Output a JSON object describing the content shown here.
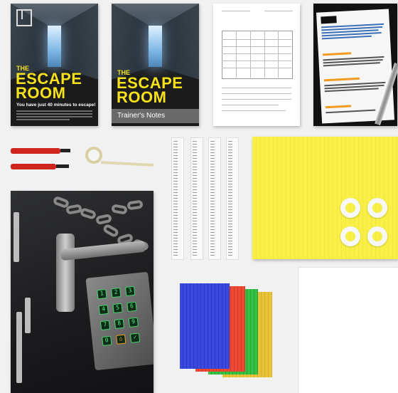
{
  "booklet_student": {
    "title_small": "THE",
    "title_large_1": "ESCAPE",
    "title_large_2": "ROOM",
    "subtitle": "You have just 40 minutes to escape!"
  },
  "booklet_trainer": {
    "title_small": "THE",
    "title_large_1": "ESCAPE",
    "title_large_2": "ROOM",
    "subtitle": "Trainer's Notes"
  },
  "keypad": {
    "keys": [
      "1",
      "2",
      "3",
      "4",
      "5",
      "6",
      "7",
      "8",
      "9",
      "0",
      "⌂",
      "✓"
    ]
  },
  "colors": {
    "accent_yellow": "#f6e11a",
    "marker_red": "#d0241f",
    "keypad_green": "#3fd66a",
    "card_blue": "#3342d6",
    "card_red": "#e8412c",
    "card_green": "#2dbb3c",
    "card_yellow": "#e3b92f"
  }
}
